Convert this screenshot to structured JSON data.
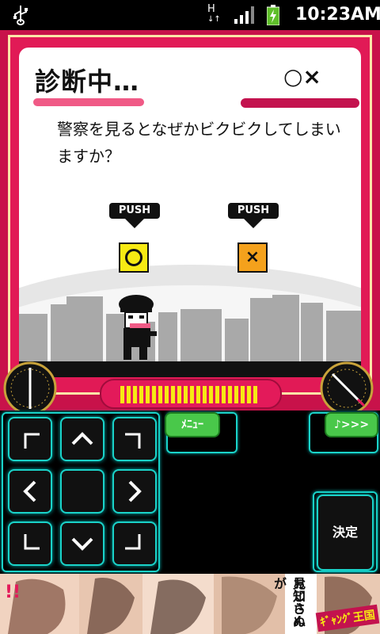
{
  "status_bar": {
    "network": "H",
    "time": "10:23AM"
  },
  "game": {
    "title": "診断中…",
    "answer_label": "○×",
    "question": "警察を見るとなぜかビクビクしてしまいますか？",
    "push_left": "PUSH",
    "push_right": "PUSH",
    "option_yes": "○",
    "option_no": "×"
  },
  "controls": {
    "menu_label": "ﾒﾆｭｰ",
    "next_label": "♪>>>",
    "decide_label": "決定"
  },
  "ad": {
    "text1": "見知らぬ",
    "text2": "おじさんが",
    "logo": "ｷﾞｬﾝｸﾞ王国"
  }
}
